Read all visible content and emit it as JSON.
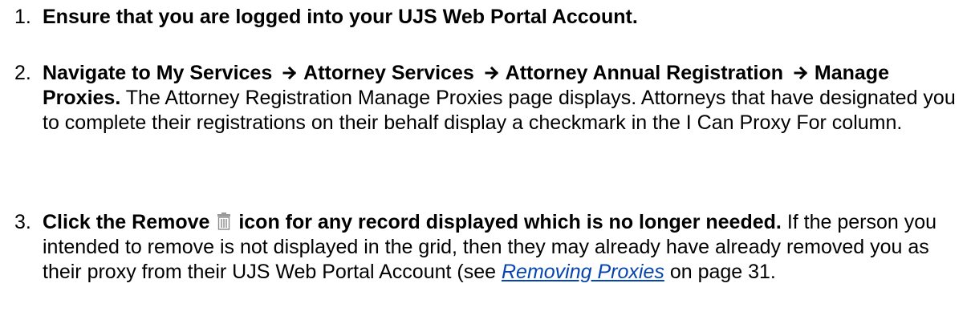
{
  "steps": [
    {
      "number": "1.",
      "bold": "Ensure that you are logged into your UJS Web Portal Account."
    },
    {
      "number": "2.",
      "nav_prefix": "Navigate to My Services",
      "nav_path": [
        "Attorney Services",
        "Attorney Annual Registration",
        "Manage Proxies."
      ],
      "text": "The Attorney Registration Manage Proxies page displays. Attorneys that have designated you to complete their registrations on their behalf display a checkmark in the I Can Proxy For column."
    },
    {
      "number": "3.",
      "bold_before_icon": "Click the Remove",
      "icon": "trash-icon",
      "bold_after_icon": "icon for any record displayed which is no longer needed.",
      "text": "If the person you intended to remove is not displayed in the grid, then they may already have already removed you as their proxy from their UJS Web Portal Account (see",
      "link_text": "Removing Proxies",
      "text_after_link": "on page 31."
    }
  ],
  "colors": {
    "link": "#0645ad",
    "icon_gray": "#8a8a8a"
  }
}
